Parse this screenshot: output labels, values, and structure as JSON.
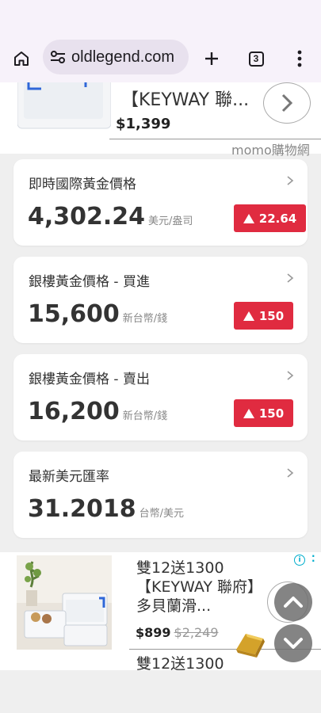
{
  "browser": {
    "url_display": "oldlegend.com",
    "tab_count": "3"
  },
  "ad_top": {
    "title": "【KEYWAY 聯...",
    "price": "$1,399",
    "vendor": "momo購物網"
  },
  "cards": [
    {
      "title": "即時國際黃金價格",
      "value": "4,302.24",
      "unit": "美元/盎司",
      "change": "22.64",
      "direction": "up"
    },
    {
      "title": "銀樓黃金價格 - 買進",
      "value": "15,600",
      "unit": "新台幣/錢",
      "change": "150",
      "direction": "up"
    },
    {
      "title": "銀樓黃金價格 - 賣出",
      "value": "16,200",
      "unit": "新台幣/錢",
      "change": "150",
      "direction": "up"
    },
    {
      "title": "最新美元匯率",
      "value": "31.2018",
      "unit": "台幣/美元"
    }
  ],
  "ad_bottom": {
    "headline": "雙12送1300【KEYWAY 聯府】多貝蘭滑...",
    "price": "$899",
    "old_price": "$2,249",
    "next_headline": "雙12送1300"
  },
  "colors": {
    "accent_red": "#e02b40",
    "ad_info": "#00aecd",
    "toolbar_bg": "#f7f2fa"
  },
  "icons": [
    "home-icon",
    "site-settings-icon",
    "new-tab-icon",
    "tab-switcher-icon",
    "more-menu-icon",
    "chevron-right-icon",
    "triangle-up-icon",
    "chevron-up-icon",
    "chevron-down-icon",
    "ad-info-icon"
  ]
}
